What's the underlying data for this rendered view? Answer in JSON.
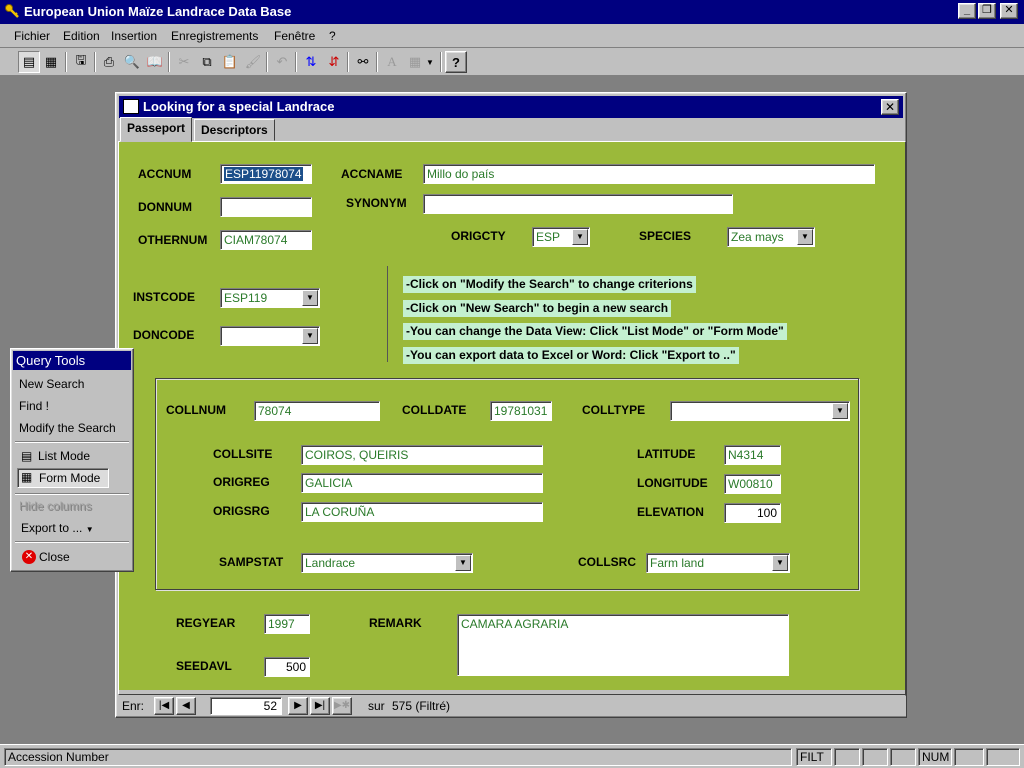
{
  "app": {
    "title": "European Union Maïze Landrace Data Base",
    "window_buttons": {
      "minimize": "_",
      "restore": "❐",
      "close": "✕"
    }
  },
  "menu": [
    "Fichier",
    "Edition",
    "Insertion",
    "Enregistrements",
    "Fenêtre",
    "?"
  ],
  "toolbar_icons": [
    "form-view-icon",
    "datasheet-view-icon",
    "save-icon",
    "print-icon",
    "print-preview-icon",
    "spelling-icon",
    "cut-icon",
    "copy-icon",
    "paste-icon",
    "format-painter-icon",
    "undo-icon",
    "sort-ascending-icon",
    "sort-descending-icon",
    "find-icon",
    "font-icon",
    "table-icon",
    "help-icon"
  ],
  "form": {
    "title": "Looking for a special Landrace",
    "close": "✕",
    "tabs": [
      "Passeport",
      "Descriptors"
    ],
    "labels": {
      "accnum": "ACCNUM",
      "accname": "ACCNAME",
      "donnum": "DONNUM",
      "synonym": "SYNONYM",
      "othernum": "OTHERNUM",
      "origcty": "ORIGCTY",
      "species": "SPECIES",
      "instcode": "INSTCODE",
      "doncode": "DONCODE",
      "collnum": "COLLNUM",
      "colldate": "COLLDATE",
      "colltype": "COLLTYPE",
      "collsite": "COLLSITE",
      "origreg": "ORIGREG",
      "origsrg": "ORIGSRG",
      "latitude": "LATITUDE",
      "longitude": "LONGITUDE",
      "elevation": "ELEVATION",
      "sampstat": "SAMPSTAT",
      "collsrc": "COLLSRC",
      "regyear": "REGYEAR",
      "remark": "REMARK",
      "seedavl": "SEEDAVL"
    },
    "values": {
      "accnum": "ESP11978074",
      "accname": "Millo do país",
      "donnum": "",
      "synonym": "",
      "othernum": "CIAM78074",
      "origcty": "ESP",
      "species": "Zea mays",
      "instcode": "ESP119",
      "doncode": "",
      "collnum": "78074",
      "colldate": "19781031",
      "colltype": "",
      "collsite": "COIROS, QUEIRIS",
      "origreg": "GALICIA",
      "origsrg": "LA CORUÑA",
      "latitude": "N4314",
      "longitude": "W00810",
      "elevation": "100",
      "sampstat": "Landrace",
      "collsrc": "Farm land",
      "regyear": "1997",
      "remark": "CAMARA AGRARIA",
      "seedavl": "500"
    },
    "hints": [
      "-Click on \"Modify the Search\" to change criterions",
      "-Click on \"New Search\" to begin a new search",
      "-You can change the Data View: Click \"List Mode\" or \"Form Mode\"",
      "-You can export data to Excel or Word: Click \"Export to ..\""
    ],
    "navigator": {
      "label": "Enr:",
      "record": "52",
      "of_text": "sur",
      "total": "575 (Filtré)"
    }
  },
  "query_tools": {
    "title": "Query Tools",
    "items": {
      "new_search": "New Search",
      "find": "Find !",
      "modify": "Modify the Search",
      "list_mode": "List Mode",
      "form_mode": "Form Mode",
      "hide_columns": "Hide columns",
      "export": "Export to ...",
      "close": "Close"
    }
  },
  "status": {
    "text": "Accession Number",
    "filt": "FILT",
    "num": "NUM"
  },
  "colors": {
    "form_bg": "#9bb93a",
    "hint_bg": "#c4f0d0",
    "title_bg": "#000080",
    "value_text": "#2a7a2a"
  }
}
